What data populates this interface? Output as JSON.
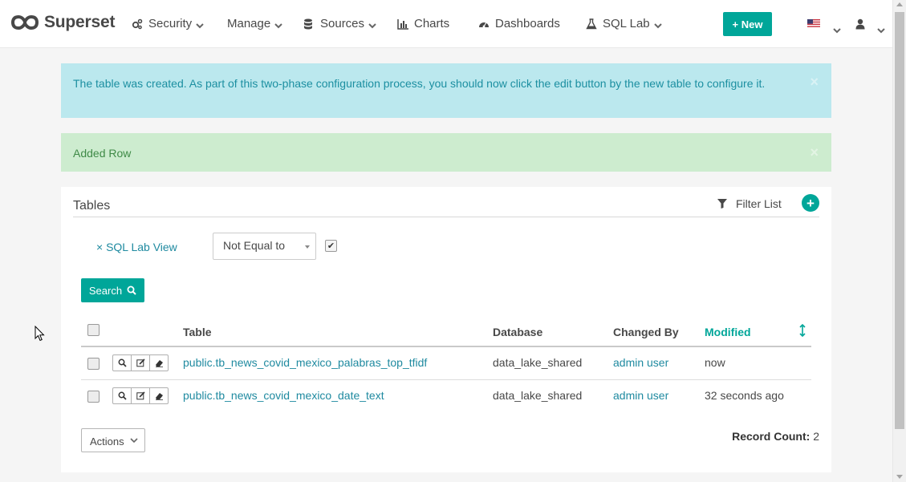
{
  "brand": {
    "name": "Superset"
  },
  "nav": {
    "security": "Security",
    "manage": "Manage",
    "sources": "Sources",
    "charts": "Charts",
    "dashboards": "Dashboards",
    "sql_lab": "SQL Lab",
    "new_button": "+ New"
  },
  "alerts": {
    "info": "The table was created. As part of this two-phase configuration process, you should now click the edit button by the new table to configure it.",
    "success": "Added Row",
    "close": "×"
  },
  "panel": {
    "title": "Tables",
    "filter_list": "Filter List",
    "add_filter": "+"
  },
  "filter": {
    "name": "× SQL Lab View",
    "operator": "Not Equal to",
    "checked_mark": "✔"
  },
  "search_button": "Search",
  "table": {
    "columns": {
      "table": "Table",
      "database": "Database",
      "changed_by": "Changed By",
      "modified": "Modified"
    },
    "rows": [
      {
        "table": "public.tb_news_covid_mexico_palabras_top_tfidf",
        "database": "data_lake_shared",
        "changed_by": "admin user",
        "modified": "now"
      },
      {
        "table": "public.tb_news_covid_mexico_date_text",
        "database": "data_lake_shared",
        "changed_by": "admin user",
        "modified": "32 seconds ago"
      }
    ]
  },
  "actions_button": "Actions",
  "record_count": {
    "label": "Record Count:",
    "value": "2"
  },
  "colors": {
    "accent": "#00a699",
    "link": "#1f8aa0",
    "info_bg": "#bbe8ee",
    "success_bg": "#cdeccf"
  }
}
